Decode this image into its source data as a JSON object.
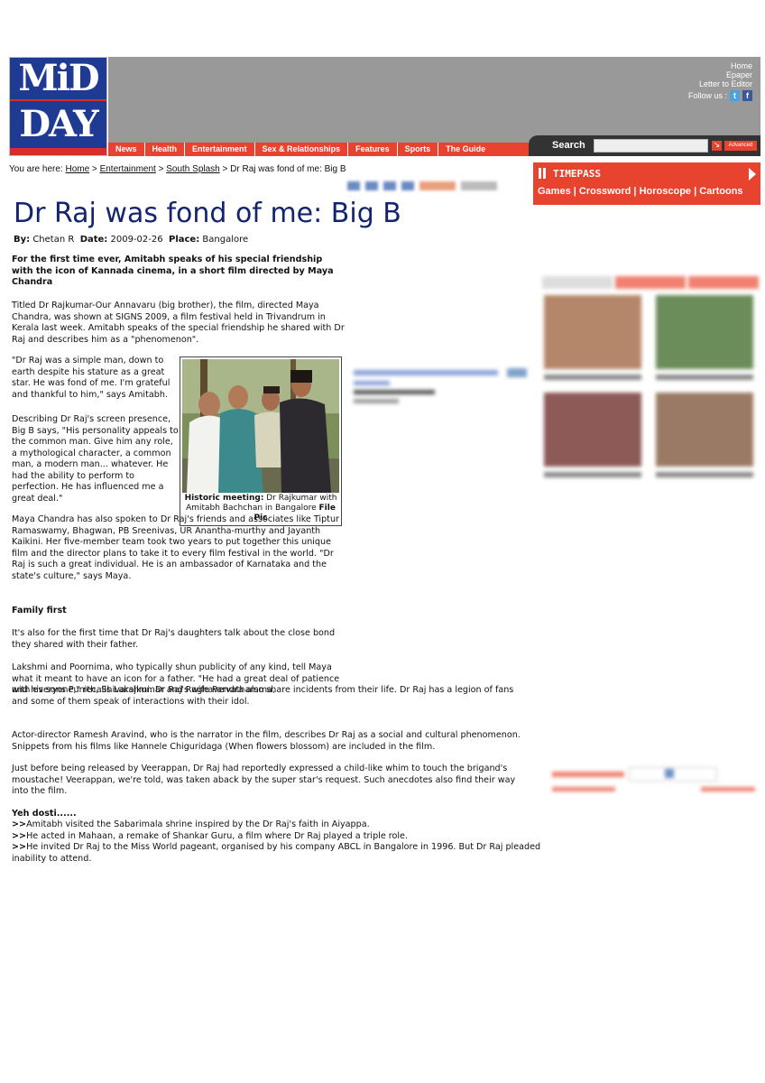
{
  "header": {
    "logo_line1": "MiD",
    "logo_line2": "DAY",
    "top_links": [
      "Home",
      "Epaper",
      "Letter to Editor"
    ],
    "follow_label": "Follow us :",
    "nav": [
      "News",
      "Health",
      "Entertainment",
      "Sex & Relationships",
      "Features",
      "Sports",
      "The Guide"
    ],
    "search_label": "Search",
    "search_value": "",
    "advanced_label": "Advanced"
  },
  "breadcrumb": {
    "prefix": "You are here: ",
    "home": "Home",
    "sep": " > ",
    "entertainment": "Entertainment",
    "section": "South Splash",
    "current": "Dr Raj was fond of me: Big B"
  },
  "timepass": {
    "title": "TIMEPASS",
    "links": [
      "Games",
      "Crossword",
      "Horoscope",
      "Cartoons"
    ]
  },
  "article": {
    "headline": "Dr Raj was fond of me: Big B",
    "by_label": "By:",
    "author": "Chetan R",
    "date_label": "Date:",
    "date": "2009-02-26",
    "place_label": "Place:",
    "place": "Bangalore",
    "lead": "For the first time ever, Amitabh speaks of his special friendship with the icon of Kannada cinema, in a short film directed by Maya Chandra",
    "para1": "Titled Dr Rajkumar-Our Annavaru (big brother), the film, directed Maya Chandra, was shown at SIGNS 2009, a film festival held in Trivandrum in Kerala last week. Amitabh speaks of the special friendship he shared with Dr Raj and describes him as a \"phenomenon\".",
    "quote": "\"Dr Raj was a simple man, down to earth despite his stature as a great star. He was fond of me. I'm grateful and thankful to him,\" says Amitabh.",
    "para_desc": "Describing Dr Raj's screen presence, Big B says, \"His personality appeals to the common man. Give him any role, a mythological character, a common man, a modern man... whatever. He had the ability to perform to perfection. He has influenced me a great deal.\"",
    "para_maya": "Maya Chandra has also spoken to Dr Raj's friends and associates like Tiptur Ramaswamy, Bhagwan, PB Sreenivas, UR Anantha-murthy and Jayanth Kaikini. Her five-member team took two years to put together this unique film and the director plans to take it to every film festival in the world.  \"Dr Raj is such a great individual. He is an ambassador of Karnataka and the state's culture,\" says Maya.",
    "family_heading": "Family first",
    "para_fam1": "It's also for the first time that Dr Raj's daughters talk about the close bond they shared with their father.",
    "para_fam2": "Lakshmi and Poornima, who typically shun publicity of any kind, tell Maya what it meant to have an icon for a father. \"He had a great deal of patience with everyone,\" recalls Lakshmi.  Dr Raj's wife Parvathamma,",
    "para_fam3": "and his sons Punith, Shivarajkumar and Raghavendra also share incidents from their life. Dr Raj has a legion of fans and some of them speak of interactions with their idol.",
    "para_actor": "Actor-director Ramesh Aravind, who is the narrator in the film, describes Dr Raj as a social and cultural phenomenon. Snippets from his films like Hannele Chiguridaga (When flowers blossom) are included in the film.",
    "para_veer": "Just before being released by Veerappan, Dr Raj had reportedly expressed a child-like whim to touch the brigand's moustache! Veerappan, we're told, was taken aback by the super star's request. Such anecdotes also find their way into the film.",
    "yeh_heading": "Yeh dosti......",
    "fact_marker": ">>",
    "facts": [
      "Amitabh visited the Sabarimala shrine inspired by the Dr Raj's faith in Aiyappa.",
      "He acted in Mahaan, a remake of Shankar Guru, a film where Dr Raj played a triple role.",
      "He invited Dr Raj to the Miss World pageant, organised by his company ABCL in Bangalore in 1996. But Dr Raj pleaded inability to attend."
    ],
    "caption_bold": "Historic meeting:",
    "caption_text": " Dr Rajkumar with Amitabh Bachchan in Bangalore ",
    "caption_credit": "File Pic"
  },
  "colors": {
    "brand_red": "#e8432f",
    "logo_blue": "#1f3a93",
    "headline_blue": "#14246e",
    "header_gray": "#999999"
  }
}
